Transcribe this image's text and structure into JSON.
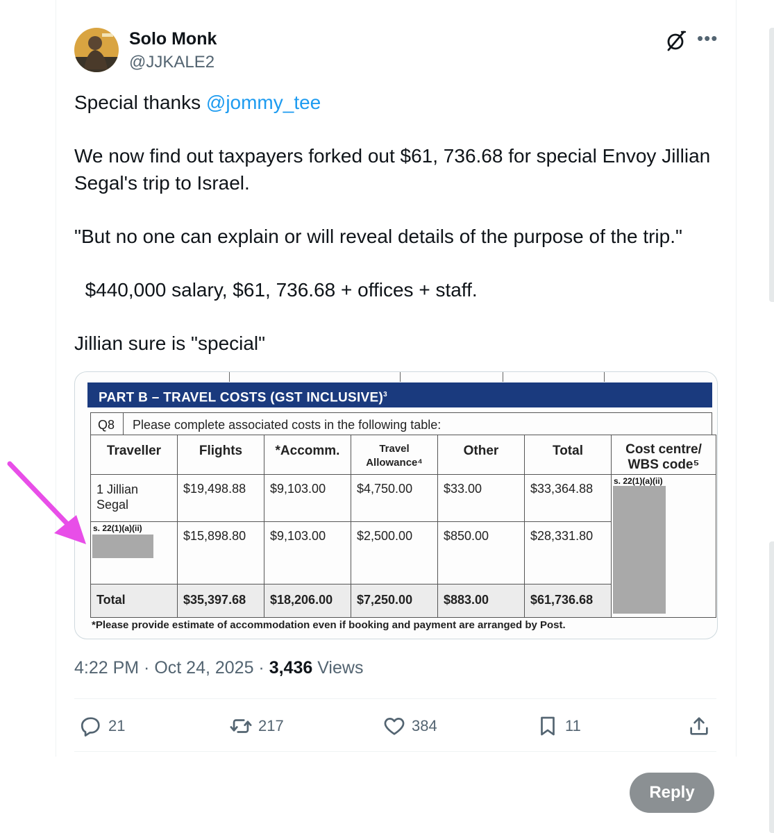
{
  "author": {
    "name": "Solo Monk",
    "handle": "@JJKALE2"
  },
  "tweet": {
    "line1_prefix": "Special thanks ",
    "line1_mention": "@jommy_tee",
    "para2": "We now find out taxpayers forked out $61, 736.68 for special Envoy Jillian Segal's trip to Israel.",
    "para3": "\"But no one can explain or will reveal details of the purpose of the trip.\"",
    "para4": "  $440,000 salary, $61, 736.68 + offices + staff.",
    "para5": "Jillian sure is \"special\""
  },
  "document": {
    "banner_title": "PART B – TRAVEL COSTS (GST INCLUSIVE)",
    "banner_sup": "3",
    "q_number": "Q8",
    "question": "Please complete associated costs in the following table:",
    "headers": {
      "traveller": "Traveller",
      "flights": "Flights",
      "accomm": "*Accomm.",
      "travel_line1": "Travel",
      "travel_line2": "Allowance⁴",
      "other": "Other",
      "total": "Total",
      "cost_line1": "Cost centre/",
      "cost_line2": "WBS code⁵"
    },
    "rows": [
      {
        "traveller_line1": "1 Jillian",
        "traveller_line2": "Segal",
        "flights": "$19,498.88",
        "accomm": "$9,103.00",
        "travel": "$4,750.00",
        "other": "$33.00",
        "total": "$33,364.88"
      },
      {
        "traveller_redaction": "s. 22(1)(a)(ii)",
        "flights": "$15,898.80",
        "accomm": "$9,103.00",
        "travel": "$2,500.00",
        "other": "$850.00",
        "total": "$28,331.80"
      }
    ],
    "total_row": {
      "label": "Total",
      "flights": "$35,397.68",
      "accomm": "$18,206.00",
      "travel": "$7,250.00",
      "other": "$883.00",
      "total": "$61,736.68"
    },
    "cost_centre_redaction": "s. 22(1)(a)(ii)",
    "footnote": "*Please provide estimate of accommodation even if booking and payment are arranged by Post."
  },
  "meta": {
    "time": "4:22 PM",
    "sep1": " · ",
    "date": "Oct 24, 2025",
    "sep2": " · ",
    "views_count": "3,436",
    "views_label": " Views"
  },
  "actions": {
    "replies": "21",
    "reposts": "217",
    "likes": "384",
    "bookmarks": "11"
  },
  "reply_button": "Reply",
  "colors": {
    "mention": "#1d9bf0",
    "banner": "#1a3a7e",
    "arrow": "#e84ee8",
    "reply_button": "#8b9093"
  }
}
